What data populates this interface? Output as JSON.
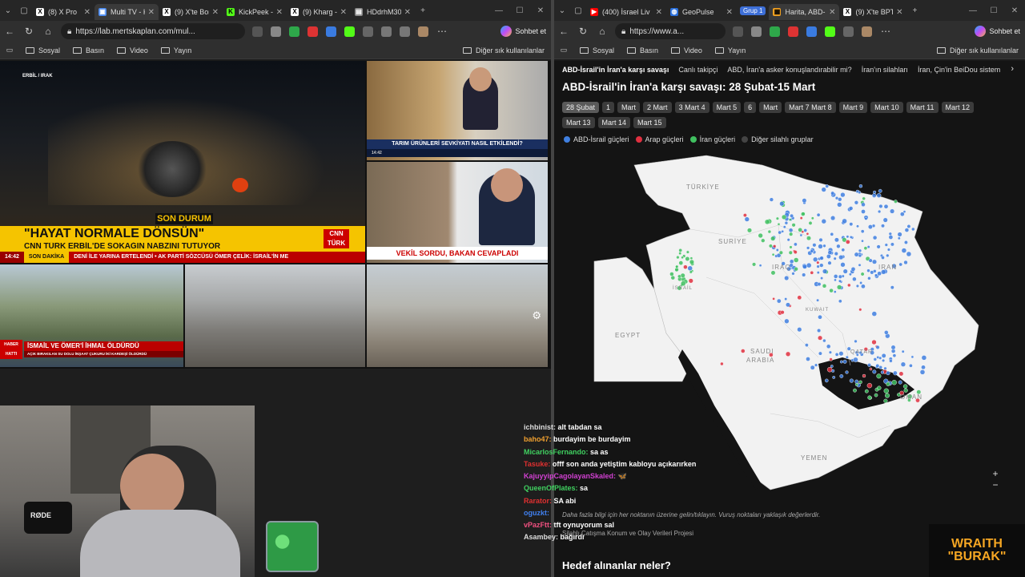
{
  "left_window": {
    "tabs": [
      {
        "label": "(8) X Pro",
        "icon": "x-logo-icon",
        "active": false
      },
      {
        "label": "Multi TV - K",
        "icon": "tv-icon",
        "active": true
      },
      {
        "label": "(9) X'te Bora",
        "icon": "x-logo-icon",
        "active": false
      },
      {
        "label": "KickPeek - K",
        "icon": "kick-icon",
        "active": false
      },
      {
        "label": "(9) Kharg - A",
        "icon": "x-logo-icon",
        "active": false
      },
      {
        "label": "HDdrhM30",
        "icon": "page-icon",
        "active": false
      }
    ],
    "url": "https://lab.mertskaplan.com/mul...",
    "favorites": [
      "Sosyal",
      "Basın",
      "Video",
      "Yayın"
    ],
    "other_favorites": "Diğer sık kullanılanlar",
    "copilot_label": "Sohbet et",
    "video_tiles": {
      "main": {
        "location_tag": "ERBİL / IRAK",
        "flash": "SON DURUM",
        "headline": "\"HAYAT NORMALE DÖNSÜN\"",
        "subheadline": "CNN TÜRK ERBİL'DE SOKAĞIN NABZINI TUTUYOR",
        "time": "14:42",
        "breaking": "SON DAKİKA",
        "ticker": "DENİ İLE YARINA ERTELENDİ  •  AK PARTİ SÖZCÜSÜ ÖMER ÇELİK: İSRAİL'İN ME",
        "logo": "CNN TÜRK"
      },
      "tile2": {
        "caption": "TARIM ÜRÜNLERİ SEVKİYATI NASIL ETKİLENDİ?",
        "time": "14:42"
      },
      "tile3": {
        "caption": "VEKİL SORDU, BAKAN CEVAPLADI"
      },
      "tile4": {
        "badge": "HABER HATTI",
        "caption": "İSMAİL VE ÖMER'İ İHMAL ÖLDÜRDÜ",
        "sub": "AÇIK BIRAKILAN SU DOLU İNŞAAT ÇUKURU İKİ KARDEŞİ ÖLDÜRDÜ"
      }
    },
    "chat": [
      {
        "user": "ichbinist:",
        "msg": "alt tabdan sa",
        "color": "#dddddd"
      },
      {
        "user": "baho47:",
        "msg": "burdayim be burdayim",
        "color": "#f0a030"
      },
      {
        "user": "MicarlosFernando:",
        "msg": "sa as",
        "color": "#40d060"
      },
      {
        "user": "Tasuke:",
        "msg": "offf son anda yetiştim kabloyu açıkarırken",
        "color": "#e03030"
      },
      {
        "user": "KajuyyipCagolayanSkaled:",
        "msg": "🦋",
        "color": "#d040d0"
      },
      {
        "user": "QueenOfPlates:",
        "msg": "sa",
        "color": "#40d060"
      },
      {
        "user": "Rarator:",
        "msg": "SA abi",
        "color": "#e03030"
      },
      {
        "user": "oguzkt:",
        "msg": "",
        "color": "#4080f0"
      },
      {
        "user": "vPazFtt:",
        "msg": "tft oynuyorum sal",
        "color": "#f05080"
      },
      {
        "user": "Asambey:",
        "msg": "bağırdı",
        "color": "#dddddd"
      }
    ]
  },
  "right_window": {
    "tabs": [
      {
        "label": "(400) İsrael Liv",
        "icon": "youtube-icon",
        "active": false
      },
      {
        "label": "GeoPulse",
        "icon": "globe-icon",
        "active": false
      },
      {
        "label": "Harita, ABD-İs",
        "icon": "map-icon",
        "active": true
      },
      {
        "label": "(9) X'te BPT",
        "icon": "x-logo-icon",
        "active": false
      }
    ],
    "group_label": "Grup 1",
    "url": "https://www.a...",
    "favorites": [
      "Sosyal",
      "Basın",
      "Video",
      "Yayın"
    ],
    "other_favorites": "Diğer sık kullanılanlar",
    "copilot_label": "Sohbet et",
    "topnav": [
      "ABD-İsrail'in İran'a karşı savaşı",
      "Canlı takipçi",
      "ABD, İran'a asker konuşlandırabilir mi?",
      "İran'ın silahları",
      "İran, Çin'in BeiDou sistem"
    ],
    "page_title": "ABD-İsrail'in İran'a karşı savaşı: 28 Şubat-15 Mart",
    "date_chips": [
      "28 Şubat",
      "1",
      "Mart",
      "2 Mart",
      "3 Mart 4",
      "Mart 5",
      "6",
      "Mart",
      "Mart 7 Mart 8",
      "Mart 9",
      "Mart 10",
      "Mart 11",
      "Mart 12",
      "Mart 13",
      "Mart 14",
      "Mart 15"
    ],
    "legend": [
      {
        "label": "ABD-İsrail güçleri",
        "color": "#3f7fe0"
      },
      {
        "label": "Arap güçleri",
        "color": "#e03040"
      },
      {
        "label": "İran güçleri",
        "color": "#40c060"
      },
      {
        "label": "Diğer silahlı gruplar",
        "color": "#444444"
      }
    ],
    "map_labels": {
      "turkey": "TÜRKİYE",
      "syria": "SURİYE",
      "iraq": "IRAQ",
      "iran": "IRAN",
      "israel": "İSRAİL",
      "egypt": "EGYPT",
      "saudi": "SAUDI",
      "arabia": "ARABIA",
      "kuwait": "KUWAIT",
      "qatar": "QATAR",
      "oman": "OMAN",
      "yemen": "YEMEN"
    },
    "zoom_in": "+",
    "zoom_out": "−",
    "hint": "Daha fazla bilgi için her noktanın üzerine gelin/tıklayın. Vuruş noktaları yaklaşık değerlerdir.",
    "project": "Silahlı Çatışma Konum ve Olay Verileri Projesi",
    "section_heading": "Hedef alınanlar neler?"
  },
  "brand": {
    "line1": "WRAITH",
    "line2": "\"BURAK\""
  }
}
